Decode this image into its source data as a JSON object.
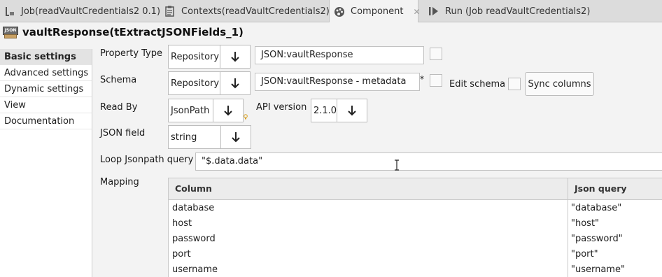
{
  "tabs": [
    {
      "label": "Job(readVaultCredentials2 0.1)",
      "icon": "job-icon",
      "active": false
    },
    {
      "label": "Contexts(readVaultCredentials2)",
      "icon": "contexts-icon",
      "active": false
    },
    {
      "label": "Component",
      "icon": "palette-icon",
      "active": true
    },
    {
      "label": "Run (Job readVaultCredentials2)",
      "icon": "run-icon",
      "active": false
    }
  ],
  "component": {
    "title": "vaultResponse(tExtractJSONFields_1)",
    "icon": "json-icon",
    "icon_text": "JSON"
  },
  "sidebar": {
    "items": [
      {
        "label": "Basic settings",
        "active": true
      },
      {
        "label": "Advanced settings"
      },
      {
        "label": "Dynamic settings"
      },
      {
        "label": "View"
      },
      {
        "label": "Documentation"
      }
    ]
  },
  "form": {
    "property_type": {
      "label": "Property Type",
      "value": "Repository",
      "repo_value": "JSON:vaultResponse"
    },
    "schema": {
      "label": "Schema",
      "value": "Repository",
      "repo_value": "JSON:vaultResponse - metadata",
      "asterisk": "*",
      "edit_label": "Edit schema",
      "sync_label": "Sync columns"
    },
    "read_by": {
      "label": "Read By",
      "value": "JsonPath"
    },
    "api_version": {
      "label": "API version",
      "value": "2.1.0"
    },
    "json_field": {
      "label": "JSON field",
      "value": "string"
    },
    "loop_query": {
      "label": "Loop Jsonpath query",
      "value": "\"$.data.data\""
    },
    "mapping": {
      "label": "Mapping"
    }
  },
  "mapping_table": {
    "headers": [
      "Column",
      "Json query"
    ],
    "rows": [
      {
        "column": "database",
        "query": "\"database\""
      },
      {
        "column": "host",
        "query": "\"host\""
      },
      {
        "column": "password",
        "query": "\"password\""
      },
      {
        "column": "port",
        "query": "\"port\""
      },
      {
        "column": "username",
        "query": "\"username\""
      }
    ]
  }
}
